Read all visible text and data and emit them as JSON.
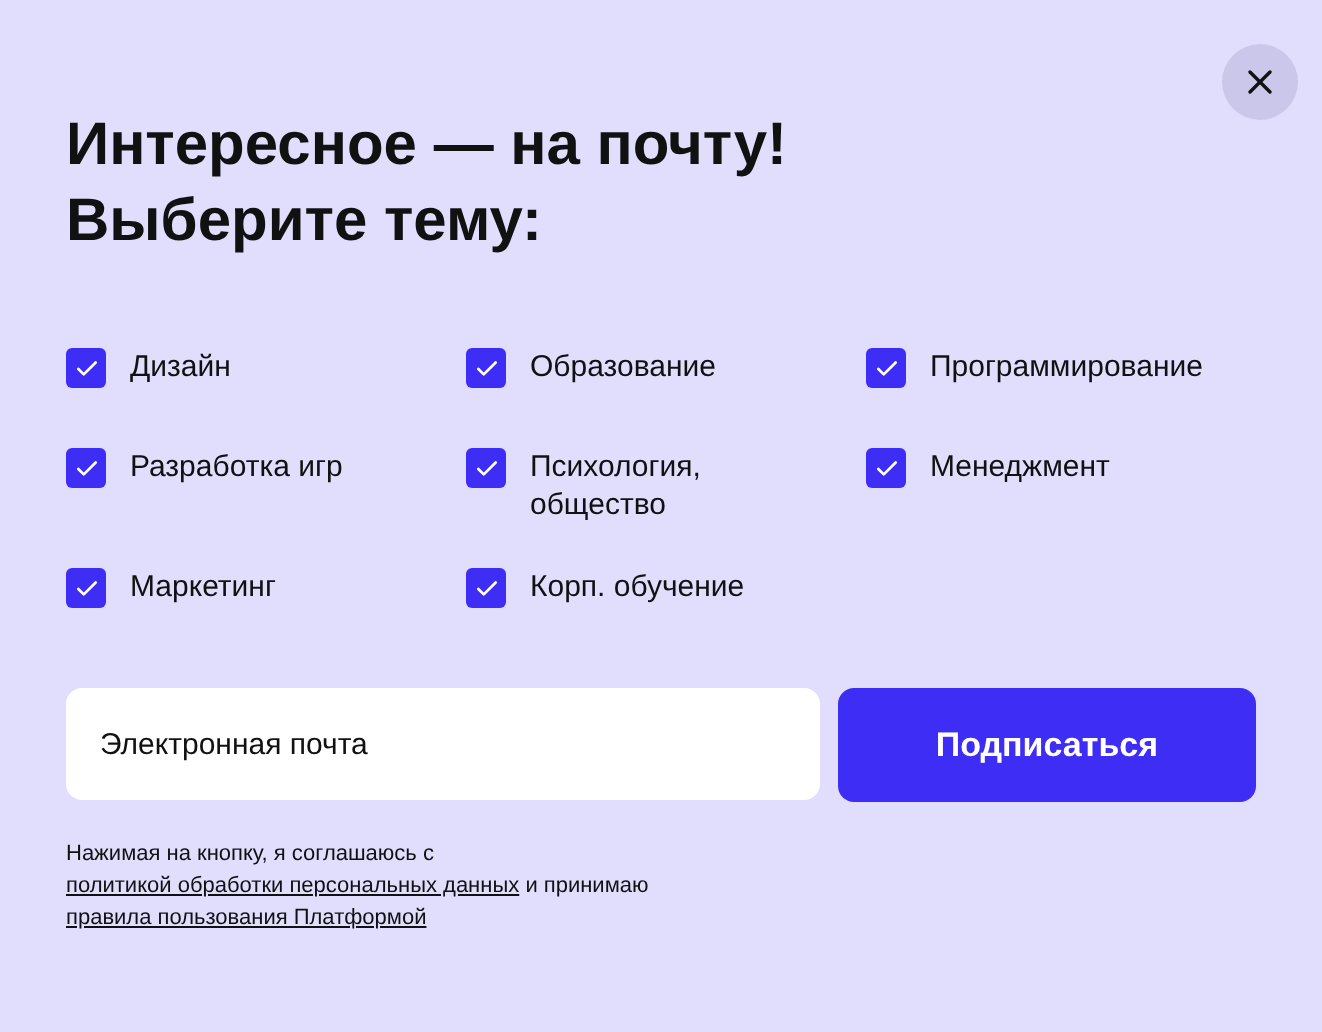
{
  "title_lines": [
    "Интересное — на почту!",
    "Выберите тему:"
  ],
  "topics": [
    {
      "label": "Дизайн",
      "checked": true
    },
    {
      "label": "Образование",
      "checked": true
    },
    {
      "label": "Программирование",
      "checked": true
    },
    {
      "label": "Разработка игр",
      "checked": true
    },
    {
      "label": "Психология, общество",
      "checked": true
    },
    {
      "label": "Менеджмент",
      "checked": true
    },
    {
      "label": "Маркетинг",
      "checked": true
    },
    {
      "label": "Корп. обучение",
      "checked": true
    }
  ],
  "email": {
    "placeholder": "Электронная почта"
  },
  "subscribe_button": "Подписаться",
  "consent": [
    {
      "kind": "text",
      "text": "Нажимая на кнопку, я соглашаюсь с"
    },
    {
      "kind": "link",
      "text": "политикой обработки персональных данных"
    },
    {
      "kind": "text",
      "text": "и принимаю"
    },
    {
      "kind": "link",
      "text": "правила пользования Платформой"
    }
  ]
}
